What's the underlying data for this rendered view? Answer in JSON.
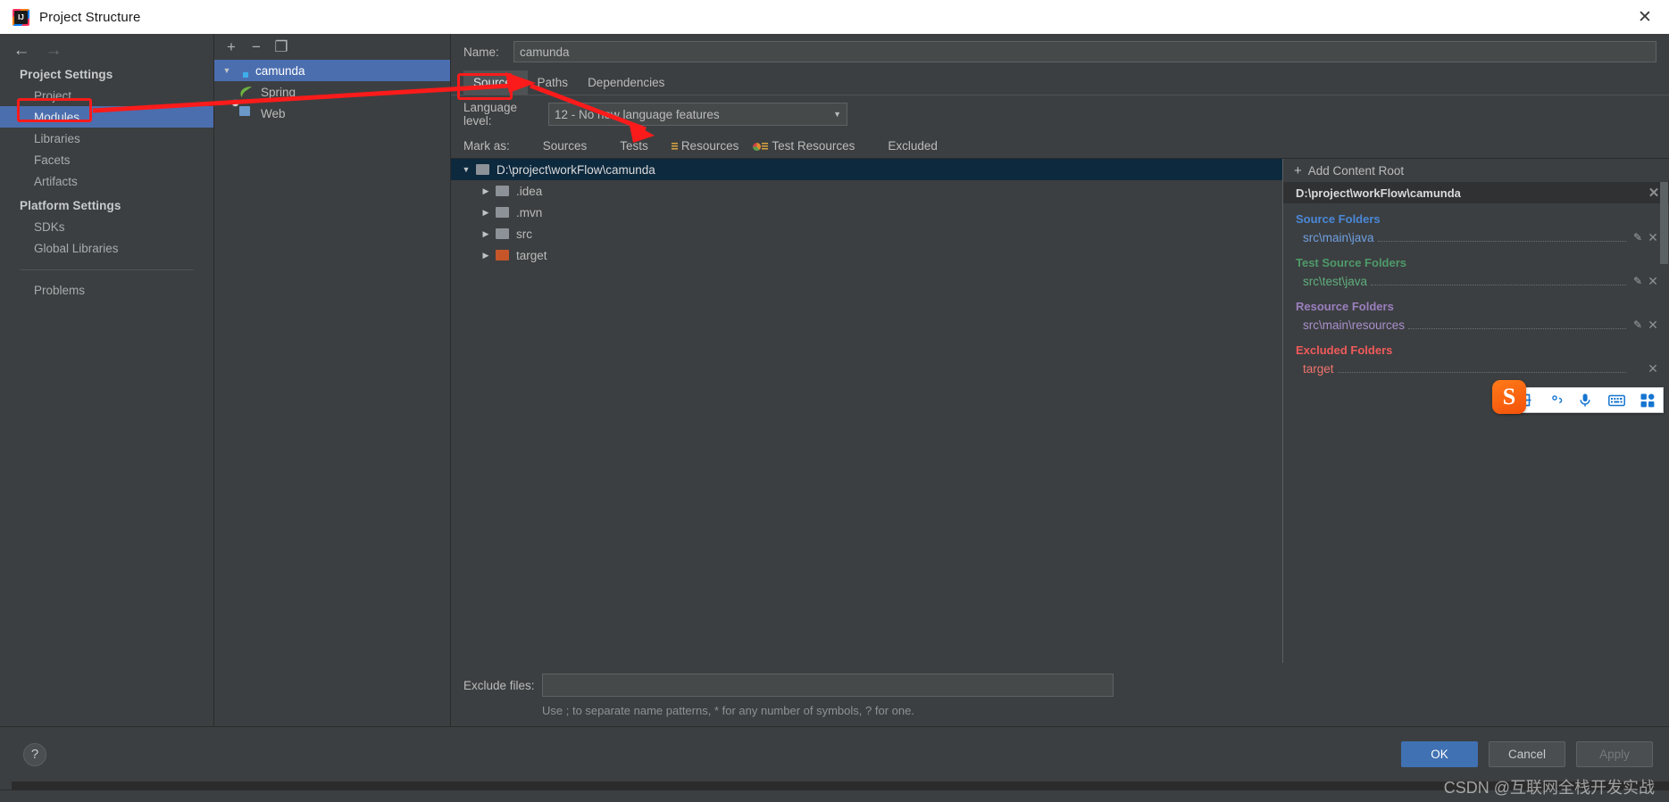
{
  "window": {
    "title": "Project Structure",
    "app_icon": "intellij-idea-icon",
    "close_label": "✕"
  },
  "nav": {
    "back_icon": "arrow-left-icon",
    "forward_icon": "arrow-right-icon",
    "groups": [
      {
        "title": "Project Settings",
        "items": [
          {
            "label": "Project",
            "selected": false
          },
          {
            "label": "Modules",
            "selected": true
          },
          {
            "label": "Libraries",
            "selected": false
          },
          {
            "label": "Facets",
            "selected": false
          },
          {
            "label": "Artifacts",
            "selected": false
          }
        ]
      },
      {
        "title": "Platform Settings",
        "items": [
          {
            "label": "SDKs",
            "selected": false
          },
          {
            "label": "Global Libraries",
            "selected": false
          }
        ]
      }
    ],
    "extra_items": [
      {
        "label": "Problems",
        "selected": false
      }
    ]
  },
  "modules": {
    "toolbar": {
      "add_label": "+",
      "remove_label": "−",
      "copy_label": "❐"
    },
    "tree": [
      {
        "label": "camunda",
        "icon": "module-folder-icon",
        "twisty": "▼",
        "selected": true,
        "depth": 0
      },
      {
        "label": "Spring",
        "icon": "spring-leaf-icon",
        "twisty": "",
        "selected": false,
        "depth": 1
      },
      {
        "label": "Web",
        "icon": "web-globe-icon",
        "twisty": "",
        "selected": false,
        "depth": 1
      }
    ]
  },
  "main": {
    "name_label": "Name:",
    "name_value": "camunda",
    "tabs": [
      {
        "label": "Sources",
        "active": true
      },
      {
        "label": "Paths",
        "active": false
      },
      {
        "label": "Dependencies",
        "active": false
      }
    ],
    "language_level_label": "Language level:",
    "language_level_value": "12 - No new language features",
    "language_level_caret": "▼",
    "mark_as_label": "Mark as:",
    "mark_as_items": [
      {
        "label": "Sources",
        "color": "#3c86b5",
        "kind": "plain"
      },
      {
        "label": "Tests",
        "color": "#5a9e4b",
        "kind": "plain"
      },
      {
        "label": "Resources",
        "color": "#9aa0a6",
        "kind": "lines"
      },
      {
        "label": "Test Resources",
        "color": "#9aa0a6",
        "kind": "pie-lines"
      },
      {
        "label": "Excluded",
        "color": "#c6562a",
        "kind": "plain"
      }
    ],
    "roots_tree": [
      {
        "label": "D:\\project\\workFlow\\camunda",
        "twisty": "▼",
        "depth": 0,
        "folder": "grey",
        "selected": true
      },
      {
        "label": ".idea",
        "twisty": "▶",
        "depth": 1,
        "folder": "grey",
        "selected": false
      },
      {
        "label": ".mvn",
        "twisty": "▶",
        "depth": 1,
        "folder": "grey",
        "selected": false
      },
      {
        "label": "src",
        "twisty": "▶",
        "depth": 1,
        "folder": "grey",
        "selected": false
      },
      {
        "label": "target",
        "twisty": "▶",
        "depth": 1,
        "folder": "orange",
        "selected": false
      }
    ],
    "exclude_files_label": "Exclude files:",
    "exclude_files_value": "",
    "exclude_files_hint": "Use ; to separate name patterns, * for any number of symbols, ? for one."
  },
  "details": {
    "add_content_root_label": "Add Content Root",
    "add_icon": "plus-icon",
    "content_root_path": "D:\\project\\workFlow\\camunda",
    "content_root_close_icon": "close-icon",
    "groups": [
      {
        "title": "Source Folders",
        "title_color": "#4a88d8",
        "entry_color": "#6f9fe0",
        "entries": [
          {
            "path": "src\\main\\java",
            "edit_icon": "pencil-icon",
            "remove_icon": "close-icon"
          }
        ]
      },
      {
        "title": "Test Source Folders",
        "title_color": "#4e9a6a",
        "entry_color": "#5fae7e",
        "entries": [
          {
            "path": "src\\test\\java",
            "edit_icon": "pencil-icon",
            "remove_icon": "close-icon"
          }
        ]
      },
      {
        "title": "Resource Folders",
        "title_color": "#9b7fbf",
        "entry_color": "#a98fcc",
        "entries": [
          {
            "path": "src\\main\\resources",
            "edit_icon": "pencil-icon",
            "remove_icon": "close-icon"
          }
        ]
      },
      {
        "title": "Excluded Folders",
        "title_color": "#f05a5a",
        "entry_color": "#f0736f",
        "entries": [
          {
            "path": "target",
            "edit_icon": "",
            "remove_icon": "close-icon"
          }
        ]
      }
    ]
  },
  "footer": {
    "help_label": "?",
    "ok_label": "OK",
    "cancel_label": "Cancel",
    "apply_label": "Apply"
  },
  "ime": {
    "logo_text": "S",
    "items": [
      {
        "icon": "chinese-mode-icon",
        "glyph": "中"
      },
      {
        "icon": "punctuation-mode-icon",
        "glyph": "°，"
      },
      {
        "icon": "microphone-icon",
        "glyph": "🎙"
      },
      {
        "icon": "keyboard-icon",
        "glyph": "⌨"
      },
      {
        "icon": "apps-grid-icon",
        "glyph": "⬛"
      }
    ]
  },
  "watermark": {
    "text": "CSDN @互联网全栈开发实战"
  },
  "annotations": {
    "accent_color": "#fb1b1b",
    "highlight_modules": "Modules",
    "highlight_sources_tab": "Sources"
  }
}
